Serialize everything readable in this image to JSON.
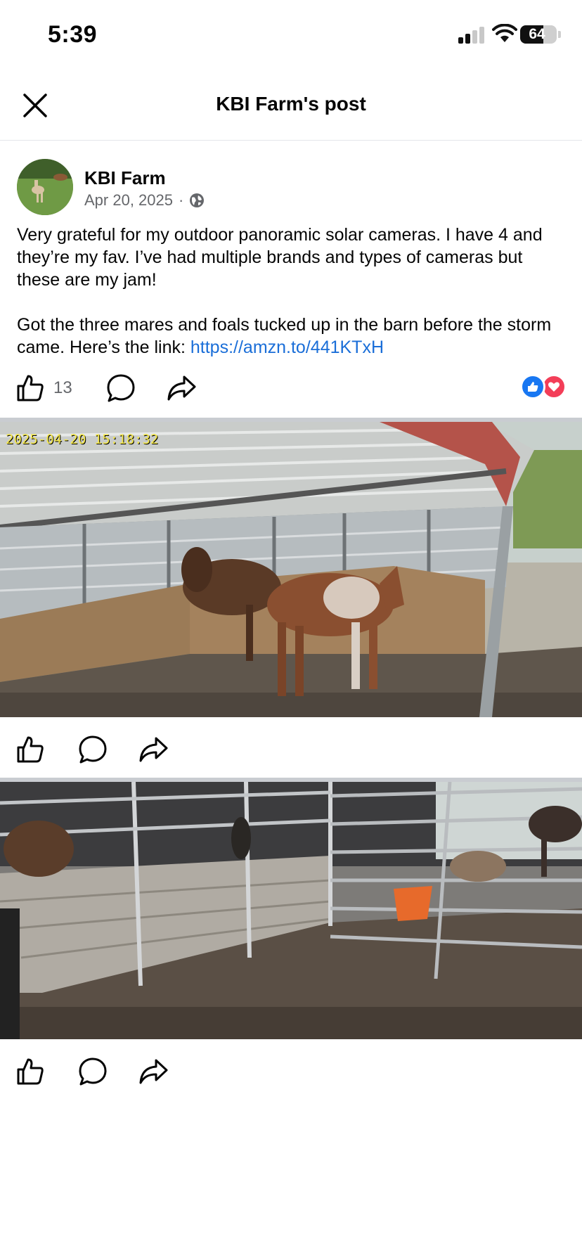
{
  "status_bar": {
    "time": "5:39",
    "battery": "64",
    "battery_level": 0.64
  },
  "header": {
    "title": "KBI Farm's post",
    "close_icon": "close-icon"
  },
  "post": {
    "author": "KBI Farm",
    "date": "Apr 20, 2025",
    "separator": "·",
    "privacy_icon": "globe-icon",
    "paragraph_1": "Very grateful for my outdoor panoramic solar cameras. I have 4 and they’re my fav. I’ve had multiple brands and types of cameras but these are my jam!",
    "paragraph_2_text": "Got the three mares and foals tucked up in the barn before the storm came. Here’s the link: ",
    "link": "https://amzn.to/441KTxH",
    "like_count": "13",
    "reaction_icons": [
      "like-reaction-icon",
      "love-reaction-icon"
    ]
  },
  "photos": [
    {
      "timestamp": "2025-04-20 15:18:32"
    },
    {
      "timestamp": ""
    }
  ],
  "colors": {
    "link": "#1a6ed8",
    "like_blue": "#1877f2",
    "love_red": "#f33e58",
    "timestamp": "#f5e84a",
    "meta_gray": "#65676b"
  }
}
